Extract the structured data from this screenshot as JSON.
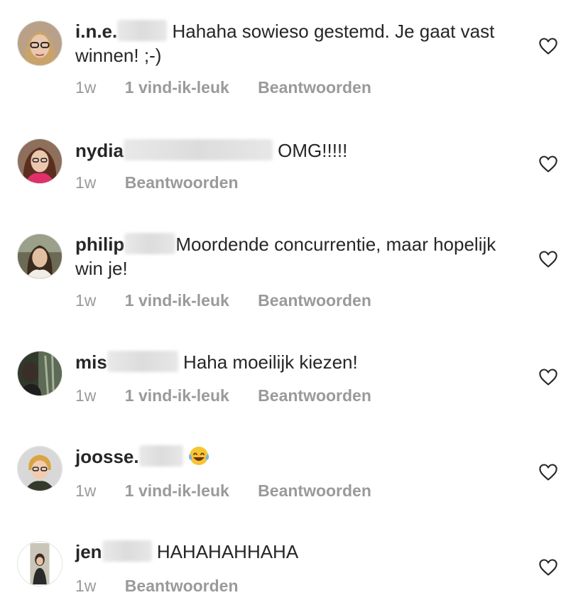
{
  "comments": [
    {
      "username": "i.n.e.",
      "text": "Hahaha sowieso gestemd. Je gaat vast winnen! ;-)",
      "time": "1w",
      "likes": "1 vind-ik-leuk",
      "reply": "Beantwoorden"
    },
    {
      "username": "nydia",
      "text": "OMG!!!!!",
      "time": "1w",
      "reply": "Beantwoorden"
    },
    {
      "username": "philip",
      "text": "Moordende concurrentie, maar hopelijk win je!",
      "time": "1w",
      "likes": "1 vind-ik-leuk",
      "reply": "Beantwoorden"
    },
    {
      "username": "mis",
      "text": "Haha moeilijk kiezen!",
      "time": "1w",
      "likes": "1 vind-ik-leuk",
      "reply": "Beantwoorden"
    },
    {
      "username": "joosse.",
      "text": "",
      "emoji": "tears-of-joy-emoji",
      "time": "1w",
      "likes": "1 vind-ik-leuk",
      "reply": "Beantwoorden"
    },
    {
      "username": "jen",
      "text": "HAHAHAHHAHA",
      "time": "1w",
      "reply": "Beantwoorden"
    }
  ],
  "icons": {
    "like": "heart-outline-icon"
  },
  "colors": {
    "text": "#262626",
    "meta": "#9a9a9a",
    "icon": "#262626"
  }
}
